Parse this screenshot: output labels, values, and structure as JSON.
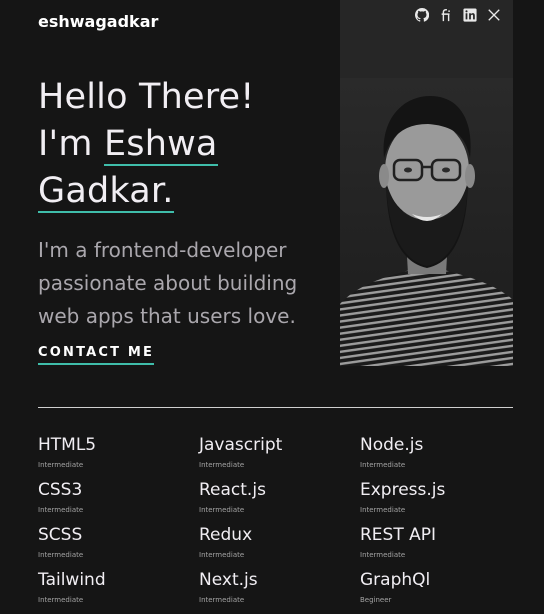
{
  "brand": "eshwagadkar",
  "social": [
    {
      "icon": "github-icon"
    },
    {
      "icon": "fiverr-icon"
    },
    {
      "icon": "linkedin-icon"
    },
    {
      "icon": "x-icon"
    }
  ],
  "hero": {
    "line1": "Hello There!",
    "line2_prefix": "I'm ",
    "name_first": "Eshwa",
    "name_last": "Gadkar.",
    "tagline": "I'm a frontend-developer passionate about building web apps that users love.",
    "cta": "CONTACT ME"
  },
  "colors": {
    "accent": "#3fbdaa",
    "background": "#151515"
  },
  "skills": [
    {
      "name": "HTML5",
      "level": "Intermediate"
    },
    {
      "name": "Javascript",
      "level": "Intermediate"
    },
    {
      "name": "Node.js",
      "level": "Intermediate"
    },
    {
      "name": "CSS3",
      "level": "Intermediate"
    },
    {
      "name": "React.js",
      "level": "Intermediate"
    },
    {
      "name": "Express.js",
      "level": "Intermediate"
    },
    {
      "name": "SCSS",
      "level": "Intermediate"
    },
    {
      "name": "Redux",
      "level": "Intermediate"
    },
    {
      "name": "REST API",
      "level": "Intermediate"
    },
    {
      "name": "Tailwind",
      "level": "Intermediate"
    },
    {
      "name": "Next.js",
      "level": "Intermediate"
    },
    {
      "name": "GraphQl",
      "level": "Begineer"
    }
  ]
}
